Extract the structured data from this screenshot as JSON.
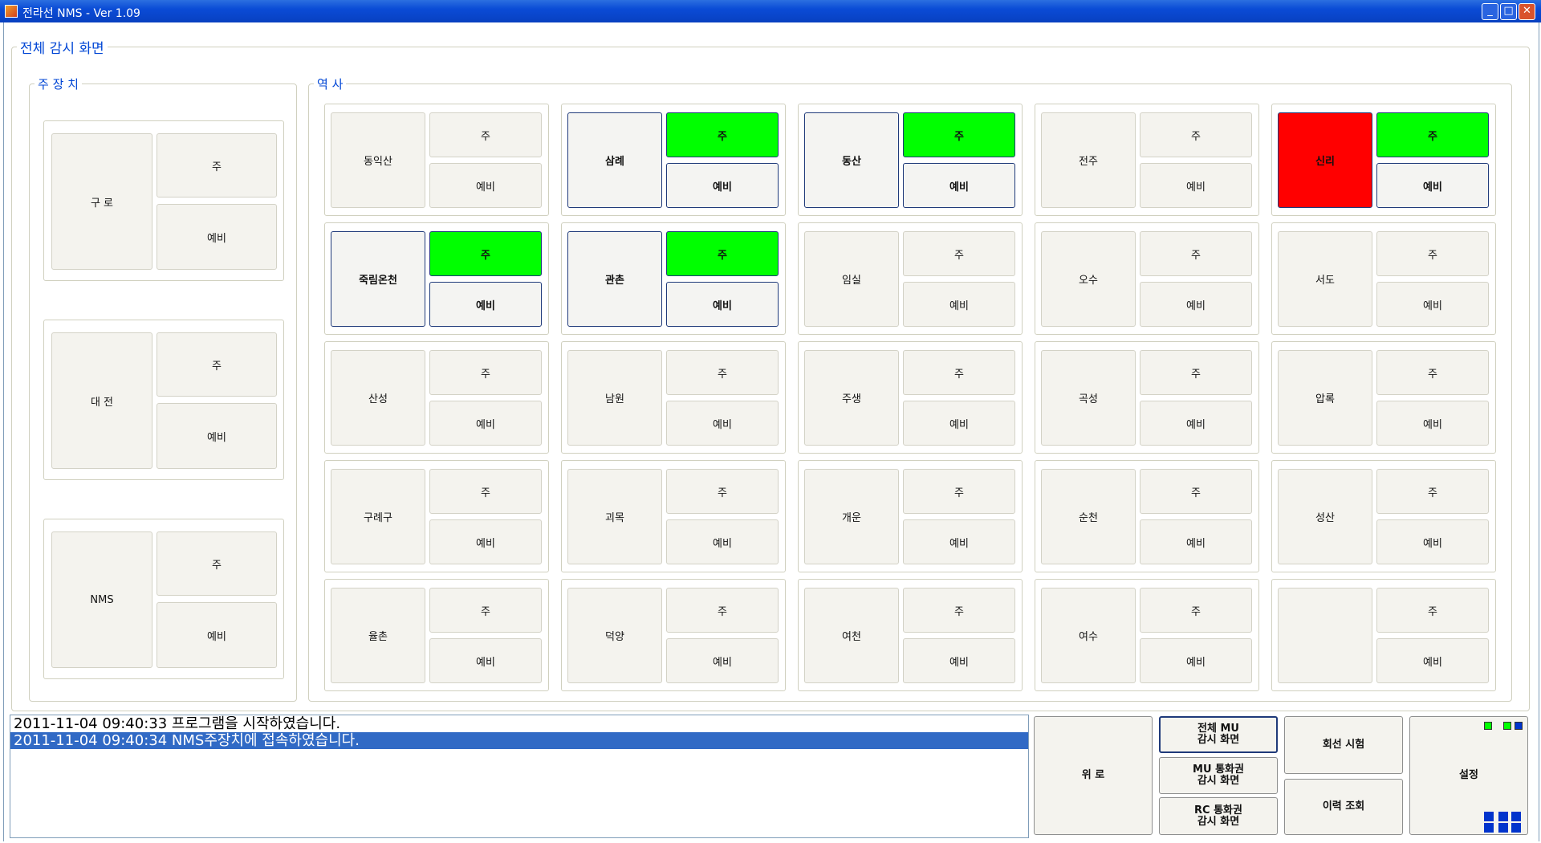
{
  "window": {
    "title": "전라선 NMS  - Ver 1.09",
    "min_glyph": "_",
    "max_glyph": "□",
    "close_glyph": "✕"
  },
  "main_group": {
    "title": "전체 감시 화면"
  },
  "device_group": {
    "title": "주 장 치",
    "devices": [
      {
        "name": "구 로",
        "main": "주",
        "backup": "예비"
      },
      {
        "name": "대 전",
        "main": "주",
        "backup": "예비"
      },
      {
        "name": "NMS",
        "main": "주",
        "backup": "예비"
      }
    ]
  },
  "station_group": {
    "title": "역 사",
    "stations": [
      {
        "name": "동익산",
        "main": "주",
        "backup": "예비",
        "state": "normal",
        "main_state": "normal"
      },
      {
        "name": "삼례",
        "main": "주",
        "backup": "예비",
        "state": "active",
        "main_state": "green"
      },
      {
        "name": "동산",
        "main": "주",
        "backup": "예비",
        "state": "active",
        "main_state": "green"
      },
      {
        "name": "전주",
        "main": "주",
        "backup": "예비",
        "state": "normal",
        "main_state": "normal"
      },
      {
        "name": "신리",
        "main": "주",
        "backup": "예비",
        "state": "red",
        "main_state": "green"
      },
      {
        "name": "죽림온천",
        "main": "주",
        "backup": "예비",
        "state": "active",
        "main_state": "green"
      },
      {
        "name": "관촌",
        "main": "주",
        "backup": "예비",
        "state": "active",
        "main_state": "green"
      },
      {
        "name": "임실",
        "main": "주",
        "backup": "예비",
        "state": "normal",
        "main_state": "normal"
      },
      {
        "name": "오수",
        "main": "주",
        "backup": "예비",
        "state": "normal",
        "main_state": "normal"
      },
      {
        "name": "서도",
        "main": "주",
        "backup": "예비",
        "state": "normal",
        "main_state": "normal"
      },
      {
        "name": "산성",
        "main": "주",
        "backup": "예비",
        "state": "normal",
        "main_state": "normal"
      },
      {
        "name": "남원",
        "main": "주",
        "backup": "예비",
        "state": "normal",
        "main_state": "normal"
      },
      {
        "name": "주생",
        "main": "주",
        "backup": "예비",
        "state": "normal",
        "main_state": "normal"
      },
      {
        "name": "곡성",
        "main": "주",
        "backup": "예비",
        "state": "normal",
        "main_state": "normal"
      },
      {
        "name": "압록",
        "main": "주",
        "backup": "예비",
        "state": "normal",
        "main_state": "normal"
      },
      {
        "name": "구례구",
        "main": "주",
        "backup": "예비",
        "state": "normal",
        "main_state": "normal"
      },
      {
        "name": "괴목",
        "main": "주",
        "backup": "예비",
        "state": "normal",
        "main_state": "normal"
      },
      {
        "name": "개운",
        "main": "주",
        "backup": "예비",
        "state": "normal",
        "main_state": "normal"
      },
      {
        "name": "순천",
        "main": "주",
        "backup": "예비",
        "state": "normal",
        "main_state": "normal"
      },
      {
        "name": "성산",
        "main": "주",
        "backup": "예비",
        "state": "normal",
        "main_state": "normal"
      },
      {
        "name": "율촌",
        "main": "주",
        "backup": "예비",
        "state": "normal",
        "main_state": "normal"
      },
      {
        "name": "덕양",
        "main": "주",
        "backup": "예비",
        "state": "normal",
        "main_state": "normal"
      },
      {
        "name": "여천",
        "main": "주",
        "backup": "예비",
        "state": "normal",
        "main_state": "normal"
      },
      {
        "name": "여수",
        "main": "주",
        "backup": "예비",
        "state": "normal",
        "main_state": "normal"
      },
      {
        "name": "",
        "main": "주",
        "backup": "예비",
        "state": "normal",
        "main_state": "normal"
      }
    ]
  },
  "log": {
    "lines": [
      "2011-11-04 09:40:33 프로그램을 시작하였습니다.",
      "2011-11-04 09:40:34 NMS주장치에 접속하였습니다."
    ]
  },
  "controls": {
    "scroll_up_label": "위 로",
    "all_mu_label": "전체 MU\n감시 화면",
    "mu_comm_label": "MU 통화권\n감시 화면",
    "rc_comm_label": "RC 통화권\n감시 화면",
    "line_test_label": "회선 시험",
    "history_label": "이력 조회",
    "settings_label": "설정"
  },
  "colors": {
    "green": "#00ff00",
    "red": "#ff0000",
    "accent": "#0046d5",
    "selection": "#316ac5"
  }
}
